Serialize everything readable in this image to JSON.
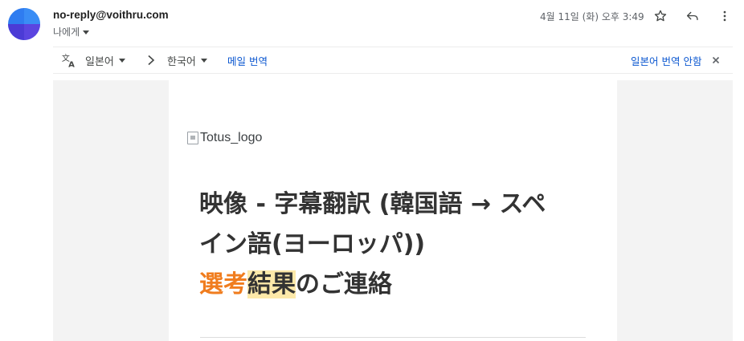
{
  "header": {
    "sender_email": "no-reply@voithru.com",
    "recipient_label": "나에게",
    "date": "4월 11일 (화) 오후 3:49",
    "icons": [
      "star-icon",
      "reply-icon",
      "more-vert-icon"
    ]
  },
  "translate_bar": {
    "source_language": "일본어",
    "target_language": "한국어",
    "translate_message_link": "메일 번역",
    "dont_translate_link": "일본어 번역 안함",
    "icons": [
      "translate-icon",
      "chevron-right-icon",
      "close-icon"
    ]
  },
  "email": {
    "logo_alt": "Totus_logo",
    "title_line1": "映像 - 字幕翻訳 (韓国語 → スペ",
    "title_line2": "イン語(ヨーロッパ))",
    "title_part_orange": "選考",
    "title_part_highlight": "結果",
    "title_part_rest": "のご連絡"
  },
  "colors": {
    "accent_orange": "#f07d1f",
    "highlight": "#fde9a9",
    "link_blue": "#0b57d0",
    "avatar_blue": "#2f7cf0",
    "avatar_purple": "#4b3bd6"
  }
}
